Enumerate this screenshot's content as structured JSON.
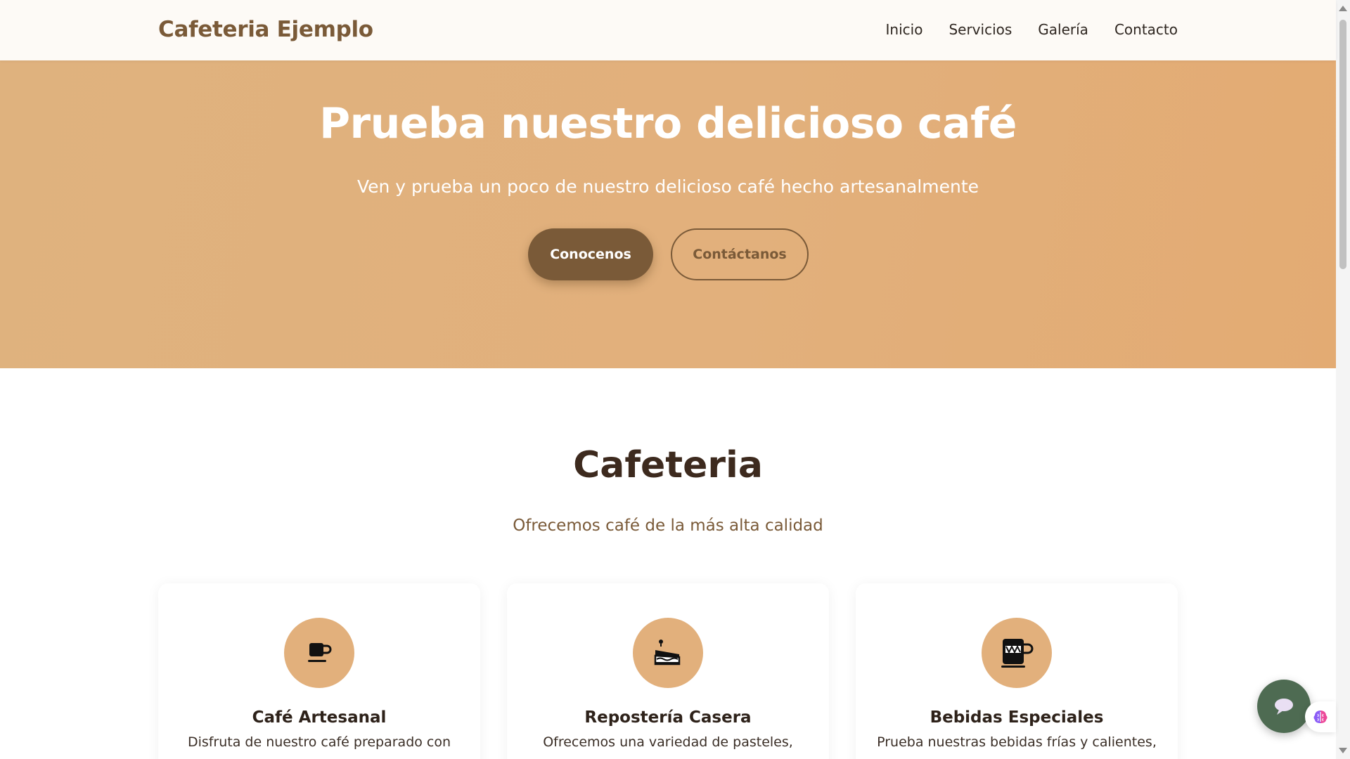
{
  "header": {
    "logo": "Cafeteria Ejemplo",
    "nav": [
      "Inicio",
      "Servicios",
      "Galería",
      "Contacto"
    ]
  },
  "hero": {
    "title": "Prueba nuestro delicioso café",
    "subtitle": "Ven y prueba un poco de nuestro delicioso café hecho artesanalmente",
    "primary_button": "Conocenos",
    "secondary_button": "Contáctanos"
  },
  "section": {
    "title": "Cafeteria",
    "subtitle": "Ofrecemos café de la más alta calidad",
    "cards": [
      {
        "icon": "coffee-mug-icon",
        "title": "Café Artesanal",
        "text": "Disfruta de nuestro café preparado con"
      },
      {
        "icon": "cake-slice-icon",
        "title": "Repostería Casera",
        "text": "Ofrecemos una variedad de pasteles,"
      },
      {
        "icon": "patterned-mug-icon",
        "title": "Bebidas Especiales",
        "text": "Prueba nuestras bebidas frías y calientes,"
      }
    ]
  },
  "widgets": {
    "chat_icon": "chat-bubble-icon",
    "ai_icon": "brain-icon"
  },
  "colors": {
    "brand": "#7a5a38",
    "hero_bg": "#e2b07c",
    "chat_bg": "#4e6b52"
  }
}
